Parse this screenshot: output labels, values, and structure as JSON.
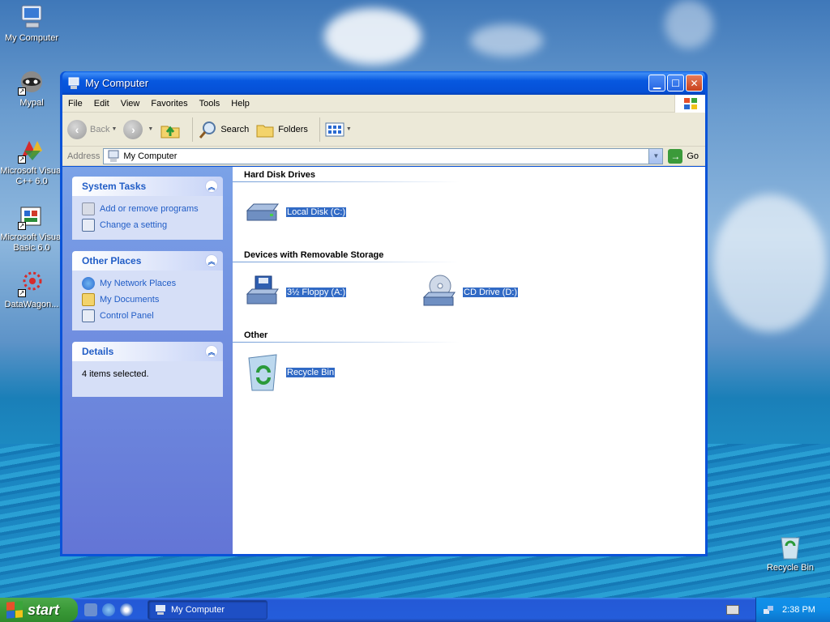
{
  "desktop": {
    "icons": [
      {
        "label": "My Computer"
      },
      {
        "label": "Mypal"
      },
      {
        "label": "Microsoft Visual\nC++ 6.0"
      },
      {
        "label": "Microsoft Visual\nBasic 6.0"
      },
      {
        "label": "DataWagon..."
      },
      {
        "label": "Recycle Bin"
      }
    ]
  },
  "window": {
    "title": "My Computer",
    "menu": [
      "File",
      "Edit",
      "View",
      "Favorites",
      "Tools",
      "Help"
    ],
    "toolbar": {
      "back": "Back",
      "search": "Search",
      "folders": "Folders"
    },
    "address": {
      "label": "Address",
      "value": "My Computer",
      "go": "Go"
    },
    "taskpane": {
      "system_tasks": {
        "title": "System Tasks",
        "links": [
          "Add or remove programs",
          "Change a setting"
        ]
      },
      "other_places": {
        "title": "Other Places",
        "links": [
          "My Network Places",
          "My Documents",
          "Control Panel"
        ]
      },
      "details": {
        "title": "Details",
        "text": "4 items selected."
      }
    },
    "groups": {
      "hdd": {
        "title": "Hard Disk Drives",
        "items": [
          "Local Disk (C:)"
        ]
      },
      "removable": {
        "title": "Devices with Removable Storage",
        "items": [
          "3½ Floppy (A:)",
          "CD Drive (D:)"
        ]
      },
      "other": {
        "title": "Other",
        "items": [
          "Recycle Bin"
        ]
      }
    }
  },
  "taskbar": {
    "start": "start",
    "task": "My Computer",
    "clock": "2:38 PM"
  },
  "colors": {
    "xp_blue": "#0a53d8",
    "selection": "#316ac5",
    "link": "#215dc6",
    "start_green": "#3a9a38"
  }
}
